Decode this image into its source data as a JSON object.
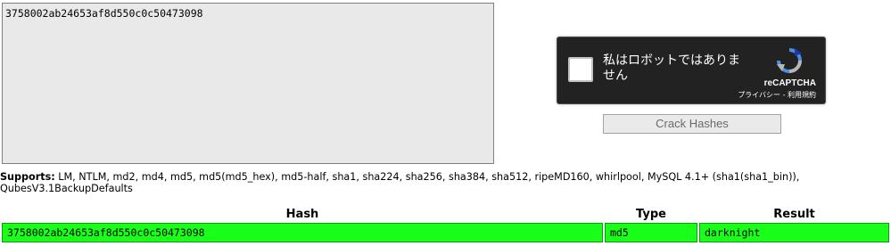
{
  "hash_input": {
    "value": "3758002ab24653af8d550c0c50473098"
  },
  "captcha": {
    "label": "私はロボットではありません",
    "brand": "reCAPTCHA",
    "links": "プライバシー - 利用規約",
    "icon": "recaptcha-logo-icon"
  },
  "crack_button": {
    "label": "Crack Hashes"
  },
  "supports": {
    "heading": "Supports:",
    "text": " LM, NTLM, md2, md4, md5, md5(md5_hex), md5-half, sha1, sha224, sha256, sha384, sha512, ripeMD160, whirlpool, MySQL 4.1+ (sha1(sha1_bin)), QubesV3.1BackupDefaults"
  },
  "results": {
    "headers": {
      "hash": "Hash",
      "type": "Type",
      "result": "Result"
    },
    "rows": [
      {
        "hash": "3758002ab24653af8d550c0c50473098",
        "type": "md5",
        "result": "darknight"
      }
    ],
    "row_color": "#1aff1a"
  }
}
